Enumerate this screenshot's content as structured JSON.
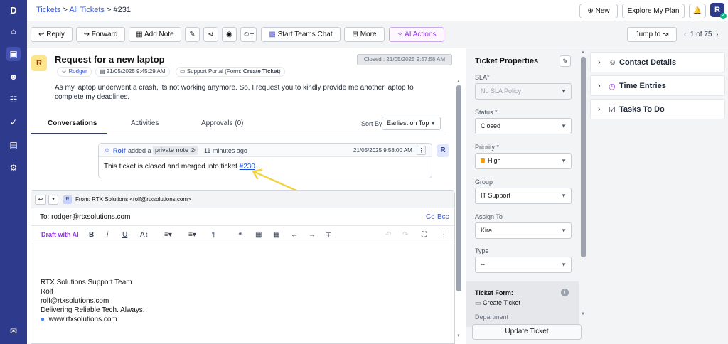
{
  "breadcrumb": {
    "tickets": "Tickets",
    "sep1": ">",
    "all_tickets": "All Tickets",
    "sep2": ">",
    "current": "#231"
  },
  "header": {
    "new_label": "New",
    "explore_label": "Explore My Plan",
    "avatar_initial": "R"
  },
  "toolbar": {
    "reply": "Reply",
    "forward": "Forward",
    "add_note": "Add Note",
    "teams_chat": "Start Teams Chat",
    "more": "More",
    "ai_actions": "AI Actions",
    "jump_to": "Jump to",
    "pagination": "1 of 75"
  },
  "ticket": {
    "requester_initial": "R",
    "title": "Request for a new laptop",
    "requester": "Rodger",
    "created": "21/05/2025 9:45:29 AM",
    "source_prefix": "Support Portal (Form: ",
    "source_form": "Create Ticket",
    "source_suffix": ")",
    "closed_badge": "Closed : 21/05/2025 9:57:58 AM",
    "description": "As my laptop underwent a crash, its not working anymore. So, I request you to kindly provide me another laptop to complete my deadlines."
  },
  "tabs": {
    "conversations": "Conversations",
    "activities": "Activities",
    "approvals": "Approvals (0)",
    "sort_label": "Sort By:",
    "sort_value": "Earliest on Top"
  },
  "note": {
    "author": "Rolf",
    "added_text": "added a",
    "badge": "private note",
    "ago": "11 minutes ago",
    "timestamp": "21/05/2025 9:58:00 AM",
    "body_text": "This ticket is closed and merged into ticket ",
    "link": "#230",
    "body_end": ".",
    "avatar_initial": "R"
  },
  "reply": {
    "from_initial": "R",
    "from": "From:  RTX Solutions <rolf@rtxsolutions.com>",
    "to": "To: rodger@rtxsolutions.com",
    "cc": "Cc",
    "bcc": "Bcc",
    "draft_ai": "Draft with AI",
    "signature": [
      "RTX Solutions Support Team",
      "Rolf",
      "rolf@rtxsolutions.com",
      "Delivering Reliable Tech. Always."
    ],
    "website": "www.rtxsolutions.com"
  },
  "properties": {
    "title": "Ticket Properties",
    "sla_label": "SLA*",
    "sla_value": "No SLA Policy",
    "status_label": "Status *",
    "status_value": "Closed",
    "priority_label": "Priority *",
    "priority_value": "High",
    "priority_color": "#f59e0b",
    "group_label": "Group",
    "group_value": "IT Support",
    "assign_label": "Assign To",
    "assign_value": "Kira",
    "type_label": "Type",
    "type_value": "--",
    "form_label": "Ticket Form:",
    "form_value": "Create Ticket",
    "department_label": "Department",
    "update_button": "Update Ticket"
  },
  "side": {
    "contact": "Contact Details",
    "time": "Time Entries",
    "tasks": "Tasks To Do"
  },
  "colors": {
    "nav": "#2e3a8c",
    "accent": "#3b5bdb",
    "ai": "#9333ea",
    "arrow": "#f2d340"
  }
}
